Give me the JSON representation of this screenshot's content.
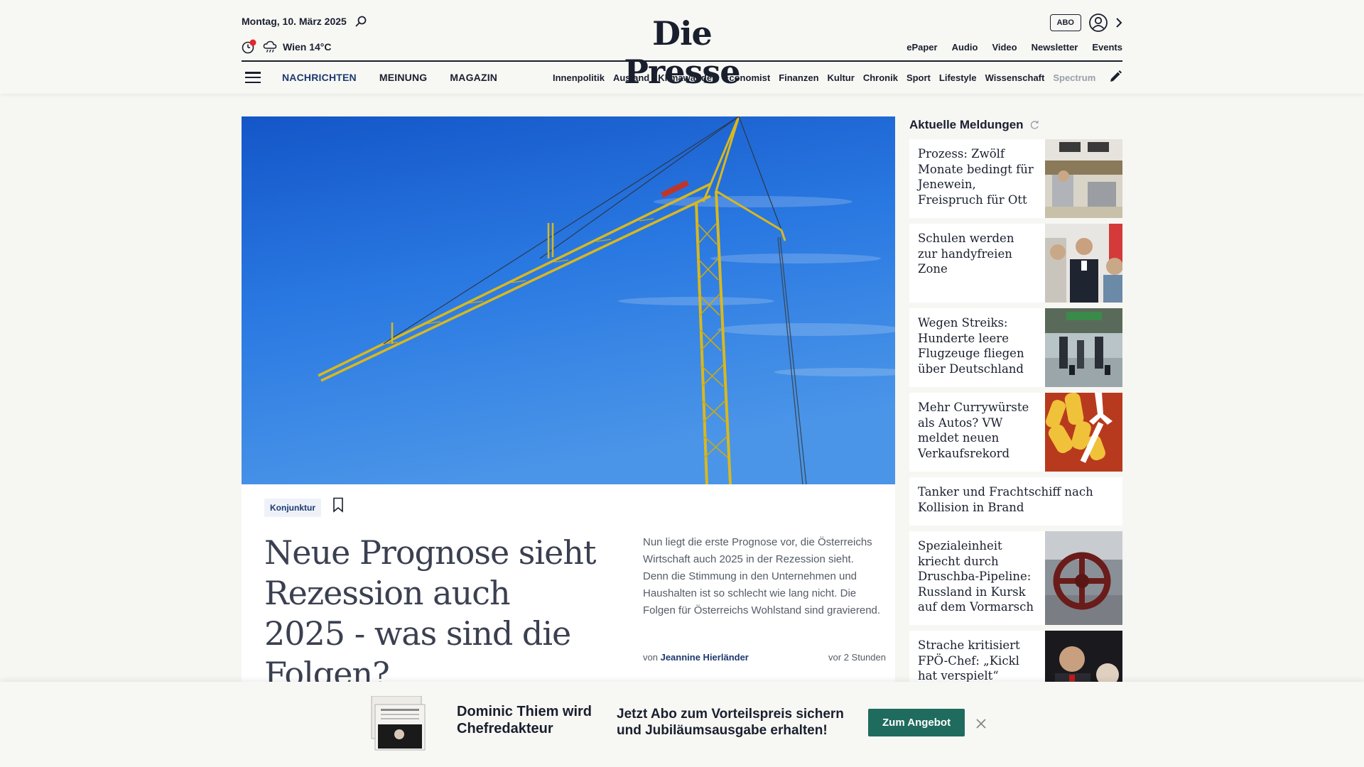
{
  "header": {
    "date": "Montag, 10. März 2025",
    "weather": "Wien 14°C",
    "logo": "Die Presse",
    "abo_label": "ABO",
    "sub_links": [
      "ePaper",
      "Audio",
      "Video",
      "Newsletter",
      "Events"
    ]
  },
  "nav": {
    "main": [
      "NACHRICHTEN",
      "MEINUNG",
      "MAGAZIN"
    ],
    "categories": [
      "Innenpolitik",
      "Ausland",
      "Klimawandel",
      "Economist",
      "Finanzen",
      "Kultur",
      "Chronik",
      "Sport",
      "Lifestyle",
      "Wissenschaft",
      "Spectrum"
    ]
  },
  "article": {
    "tag": "Konjunktur",
    "headline": "Neue Prognose sieht Rezession auch 2025 - was sind die Folgen?",
    "teaser": "Nun liegt die erste Prognose vor, die Österreichs Wirtschaft auch 2025 in der Rezession sieht. Denn die Stimmung in den Unternehmen und Haushalten ist so schlecht wie lang nicht. Die Folgen für Österreichs Wohlstand sind gravierend.",
    "byline_prefix": "von",
    "author": "Jeannine Hierländer",
    "time": "vor 2 Stunden"
  },
  "sidebar": {
    "title": "Aktuelle Meldungen",
    "items": [
      {
        "title": "Prozess: Zwölf Monate bedingt für Jenewein, Freispruch für Ott",
        "thumb": "courtroom"
      },
      {
        "title": "Schulen werden zur handyfreien Zone",
        "thumb": "press-conference"
      },
      {
        "title": "Wegen Streiks: Hunderte leere Flugzeuge fliegen über Deutschland",
        "thumb": "airport"
      },
      {
        "title": "Mehr Currywürste als Autos? VW meldet neuen Verkaufsrekord",
        "thumb": "fries"
      },
      {
        "title": "Tanker und Frachtschiff nach Kollision in Brand",
        "thumb": ""
      },
      {
        "title": "Spezialeinheit kriecht durch Druschba-Pipeline: Russland in Kursk auf dem Vormarsch",
        "thumb": "pipeline-valve"
      },
      {
        "title": "Strache kritisiert FPÖ-Chef: „Kickl hat verspielt“",
        "thumb": "politician"
      }
    ]
  },
  "promo": {
    "title": "Dominic Thiem wird Chefredakteur",
    "text": "Jetzt Abo zum Vorteilspreis sichern und Jubiläumsausgabe erhalten!",
    "button": "Zum Angebot"
  },
  "colors": {
    "accent": "#1e3a6e",
    "promo_button": "#1f6b5e",
    "sky": "#2a78e0",
    "crane": "#d8b81e"
  }
}
